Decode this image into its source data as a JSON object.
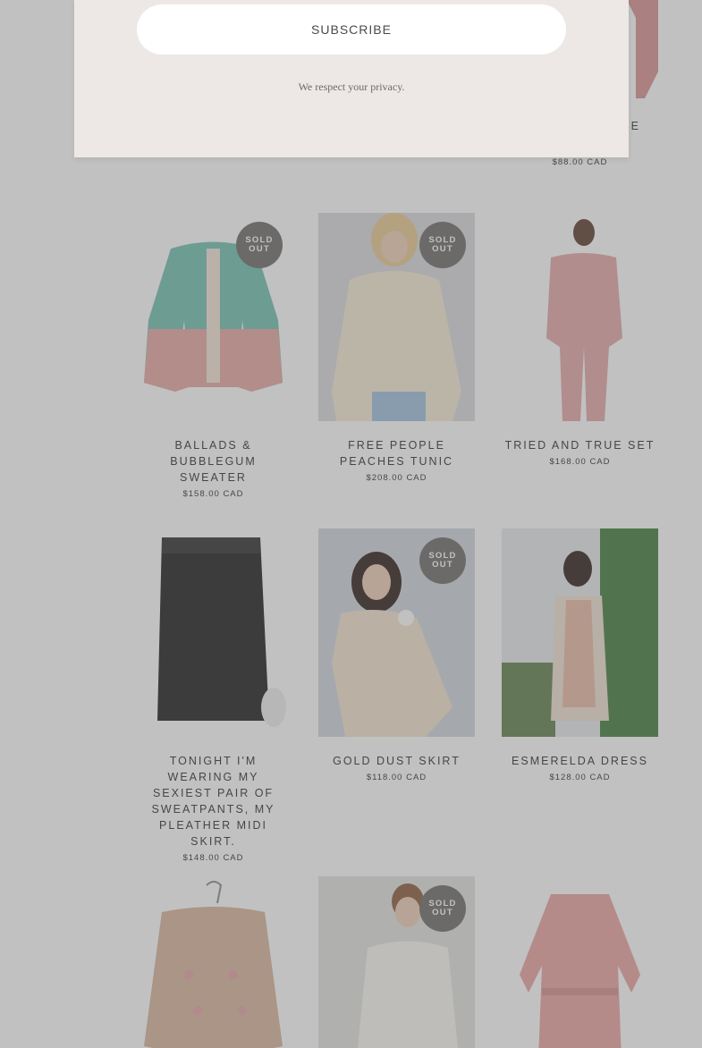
{
  "modal": {
    "subscribe_label": "SUBSCRIBE",
    "privacy_text": "We respect your privacy."
  },
  "partial_product": {
    "title_fragment": "SE",
    "price": "$88.00 CAD"
  },
  "badge": {
    "line1": "SOLD",
    "line2": "OUT"
  },
  "products": [
    {
      "title": "BALLADS & BUBBLEGUM SWEATER",
      "price": "$158.00 CAD",
      "sold_out": true
    },
    {
      "title": "FREE PEOPLE PEACHES TUNIC",
      "price": "$208.00 CAD",
      "sold_out": true
    },
    {
      "title": "TRIED AND TRUE SET",
      "price": "$168.00 CAD",
      "sold_out": false
    },
    {
      "title": "TONIGHT I'M WEARING MY SEXIEST PAIR OF SWEATPANTS, MY PLEATHER MIDI SKIRT.",
      "price": "$148.00 CAD",
      "sold_out": false
    },
    {
      "title": "GOLD DUST SKIRT",
      "price": "$118.00 CAD",
      "sold_out": true
    },
    {
      "title": "ESMERELDA DRESS",
      "price": "$128.00 CAD",
      "sold_out": false
    },
    {
      "title": "",
      "price": "",
      "sold_out": false
    },
    {
      "title": "",
      "price": "",
      "sold_out": true
    },
    {
      "title": "",
      "price": "",
      "sold_out": false
    }
  ]
}
